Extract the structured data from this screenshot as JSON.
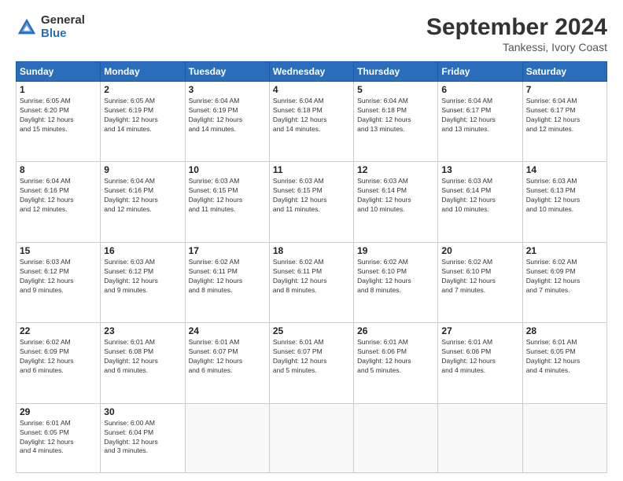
{
  "logo": {
    "general": "General",
    "blue": "Blue"
  },
  "title": "September 2024",
  "subtitle": "Tankessi, Ivory Coast",
  "headers": [
    "Sunday",
    "Monday",
    "Tuesday",
    "Wednesday",
    "Thursday",
    "Friday",
    "Saturday"
  ],
  "weeks": [
    [
      {
        "day": "1",
        "info": "Sunrise: 6:05 AM\nSunset: 6:20 PM\nDaylight: 12 hours\nand 15 minutes."
      },
      {
        "day": "2",
        "info": "Sunrise: 6:05 AM\nSunset: 6:19 PM\nDaylight: 12 hours\nand 14 minutes."
      },
      {
        "day": "3",
        "info": "Sunrise: 6:04 AM\nSunset: 6:19 PM\nDaylight: 12 hours\nand 14 minutes."
      },
      {
        "day": "4",
        "info": "Sunrise: 6:04 AM\nSunset: 6:18 PM\nDaylight: 12 hours\nand 14 minutes."
      },
      {
        "day": "5",
        "info": "Sunrise: 6:04 AM\nSunset: 6:18 PM\nDaylight: 12 hours\nand 13 minutes."
      },
      {
        "day": "6",
        "info": "Sunrise: 6:04 AM\nSunset: 6:17 PM\nDaylight: 12 hours\nand 13 minutes."
      },
      {
        "day": "7",
        "info": "Sunrise: 6:04 AM\nSunset: 6:17 PM\nDaylight: 12 hours\nand 12 minutes."
      }
    ],
    [
      {
        "day": "8",
        "info": "Sunrise: 6:04 AM\nSunset: 6:16 PM\nDaylight: 12 hours\nand 12 minutes."
      },
      {
        "day": "9",
        "info": "Sunrise: 6:04 AM\nSunset: 6:16 PM\nDaylight: 12 hours\nand 12 minutes."
      },
      {
        "day": "10",
        "info": "Sunrise: 6:03 AM\nSunset: 6:15 PM\nDaylight: 12 hours\nand 11 minutes."
      },
      {
        "day": "11",
        "info": "Sunrise: 6:03 AM\nSunset: 6:15 PM\nDaylight: 12 hours\nand 11 minutes."
      },
      {
        "day": "12",
        "info": "Sunrise: 6:03 AM\nSunset: 6:14 PM\nDaylight: 12 hours\nand 10 minutes."
      },
      {
        "day": "13",
        "info": "Sunrise: 6:03 AM\nSunset: 6:14 PM\nDaylight: 12 hours\nand 10 minutes."
      },
      {
        "day": "14",
        "info": "Sunrise: 6:03 AM\nSunset: 6:13 PM\nDaylight: 12 hours\nand 10 minutes."
      }
    ],
    [
      {
        "day": "15",
        "info": "Sunrise: 6:03 AM\nSunset: 6:12 PM\nDaylight: 12 hours\nand 9 minutes."
      },
      {
        "day": "16",
        "info": "Sunrise: 6:03 AM\nSunset: 6:12 PM\nDaylight: 12 hours\nand 9 minutes."
      },
      {
        "day": "17",
        "info": "Sunrise: 6:02 AM\nSunset: 6:11 PM\nDaylight: 12 hours\nand 8 minutes."
      },
      {
        "day": "18",
        "info": "Sunrise: 6:02 AM\nSunset: 6:11 PM\nDaylight: 12 hours\nand 8 minutes."
      },
      {
        "day": "19",
        "info": "Sunrise: 6:02 AM\nSunset: 6:10 PM\nDaylight: 12 hours\nand 8 minutes."
      },
      {
        "day": "20",
        "info": "Sunrise: 6:02 AM\nSunset: 6:10 PM\nDaylight: 12 hours\nand 7 minutes."
      },
      {
        "day": "21",
        "info": "Sunrise: 6:02 AM\nSunset: 6:09 PM\nDaylight: 12 hours\nand 7 minutes."
      }
    ],
    [
      {
        "day": "22",
        "info": "Sunrise: 6:02 AM\nSunset: 6:09 PM\nDaylight: 12 hours\nand 6 minutes."
      },
      {
        "day": "23",
        "info": "Sunrise: 6:01 AM\nSunset: 6:08 PM\nDaylight: 12 hours\nand 6 minutes."
      },
      {
        "day": "24",
        "info": "Sunrise: 6:01 AM\nSunset: 6:07 PM\nDaylight: 12 hours\nand 6 minutes."
      },
      {
        "day": "25",
        "info": "Sunrise: 6:01 AM\nSunset: 6:07 PM\nDaylight: 12 hours\nand 5 minutes."
      },
      {
        "day": "26",
        "info": "Sunrise: 6:01 AM\nSunset: 6:06 PM\nDaylight: 12 hours\nand 5 minutes."
      },
      {
        "day": "27",
        "info": "Sunrise: 6:01 AM\nSunset: 6:06 PM\nDaylight: 12 hours\nand 4 minutes."
      },
      {
        "day": "28",
        "info": "Sunrise: 6:01 AM\nSunset: 6:05 PM\nDaylight: 12 hours\nand 4 minutes."
      }
    ],
    [
      {
        "day": "29",
        "info": "Sunrise: 6:01 AM\nSunset: 6:05 PM\nDaylight: 12 hours\nand 4 minutes."
      },
      {
        "day": "30",
        "info": "Sunrise: 6:00 AM\nSunset: 6:04 PM\nDaylight: 12 hours\nand 3 minutes."
      },
      {
        "day": "",
        "info": ""
      },
      {
        "day": "",
        "info": ""
      },
      {
        "day": "",
        "info": ""
      },
      {
        "day": "",
        "info": ""
      },
      {
        "day": "",
        "info": ""
      }
    ]
  ]
}
